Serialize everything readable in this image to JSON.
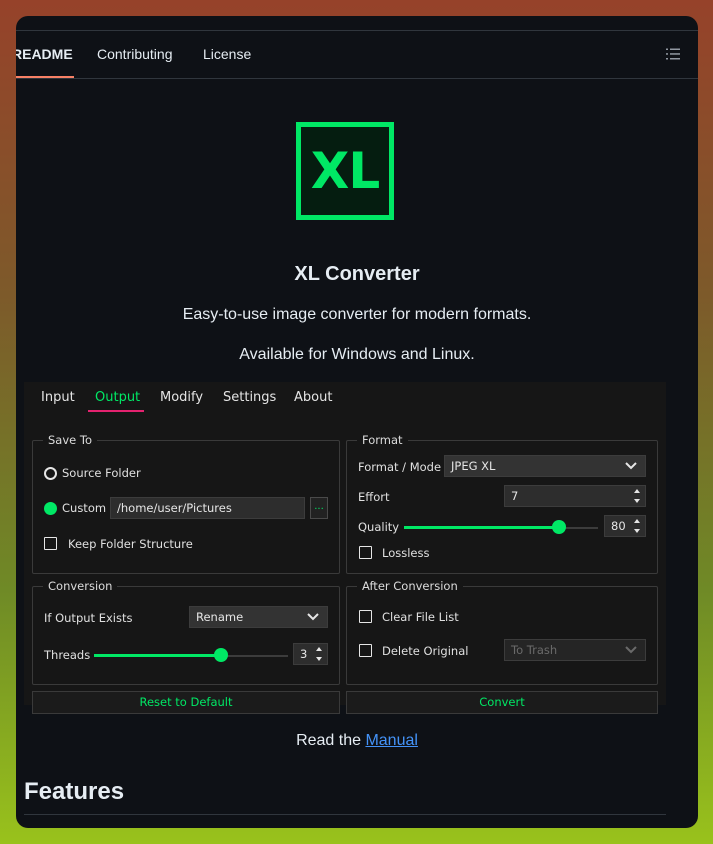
{
  "tabs": {
    "readme": "README",
    "contributing": "Contributing",
    "license": "License"
  },
  "logo_text": "XL",
  "title": "XL Converter",
  "tagline": "Easy-to-use image converter for modern formats.",
  "platforms": "Available for Windows and Linux.",
  "app": {
    "tabs": [
      "Input",
      "Output",
      "Modify",
      "Settings",
      "About"
    ],
    "active_tab": "Output",
    "save_to": {
      "title": "Save To",
      "source_folder": "Source Folder",
      "custom": "Custom",
      "custom_path": "/home/user/Pictures",
      "browse": "...",
      "keep_structure": "Keep Folder Structure"
    },
    "format": {
      "title": "Format",
      "mode_label": "Format / Mode",
      "mode_value": "JPEG XL",
      "effort_label": "Effort",
      "effort_value": "7",
      "quality_label": "Quality",
      "quality_value": "80",
      "lossless": "Lossless"
    },
    "conversion": {
      "title": "Conversion",
      "if_exists_label": "If Output Exists",
      "if_exists_value": "Rename",
      "threads_label": "Threads",
      "threads_value": "3"
    },
    "after": {
      "title": "After Conversion",
      "clear_list": "Clear File List",
      "delete_original": "Delete Original",
      "delete_mode": "To Trash"
    },
    "reset_button": "Reset to Default",
    "convert_button": "Convert"
  },
  "manual_prefix": "Read the ",
  "manual_link": "Manual",
  "features_heading": "Features",
  "colors": {
    "accent": "#00e865",
    "tab_underline": "#e4226f",
    "link": "#4493f8"
  }
}
